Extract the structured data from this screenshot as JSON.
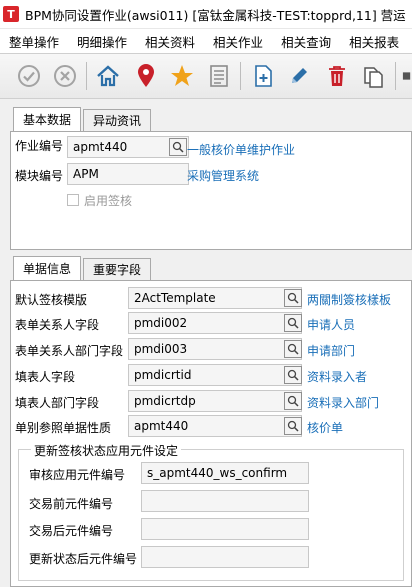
{
  "window": {
    "title": "BPM协同设置作业(awsi011)    [富钛金属科技-TEST:topprd,11]    营运"
  },
  "menu": {
    "items": [
      "整单操作",
      "明细操作",
      "相关资料",
      "相关作业",
      "相关查询",
      "相关报表",
      "相关"
    ]
  },
  "toolbar": {
    "icons": [
      "confirm-icon",
      "cancel-icon",
      "home-icon",
      "location-pin-icon",
      "star-icon",
      "list-icon",
      "add-icon",
      "edit-icon",
      "delete-icon",
      "copy-icon"
    ]
  },
  "top_tabs": [
    {
      "label": "基本数据"
    },
    {
      "label": "异动资讯"
    }
  ],
  "basic": {
    "job_no_label": "作业编号",
    "job_no_value": "apmt440",
    "job_no_link": "一般核价单维护作业",
    "module_label": "模块编号",
    "module_value": "APM",
    "module_link": "采购管理系统",
    "enable_sign_label": "启用签核"
  },
  "bottom_tabs": [
    {
      "label": "单据信息"
    },
    {
      "label": "重要字段"
    }
  ],
  "doc": {
    "rows": [
      {
        "label": "默认签核模版",
        "value": "2ActTemplate",
        "link": "两關制簽核樣板"
      },
      {
        "label": "表单关系人字段",
        "value": "pmdi002",
        "link": "申请人员"
      },
      {
        "label": "表单关系人部门字段",
        "value": "pmdi003",
        "link": "申请部门"
      },
      {
        "label": "填表人字段",
        "value": "pmdicrtid",
        "link": "资料录入者"
      },
      {
        "label": "填表人部门字段",
        "value": "pmdicrtdp",
        "link": "资料录入部门"
      },
      {
        "label": "单别参照单据性质",
        "value": "apmt440",
        "link": "核价单"
      }
    ]
  },
  "group": {
    "title": "更新签核状态应用元件设定",
    "rows": [
      {
        "label": "审核应用元件编号",
        "value": "s_apmt440_ws_confirm"
      },
      {
        "label": "交易前元件编号",
        "value": ""
      },
      {
        "label": "交易后元件编号",
        "value": ""
      },
      {
        "label": "更新状态后元件编号",
        "value": ""
      }
    ]
  }
}
